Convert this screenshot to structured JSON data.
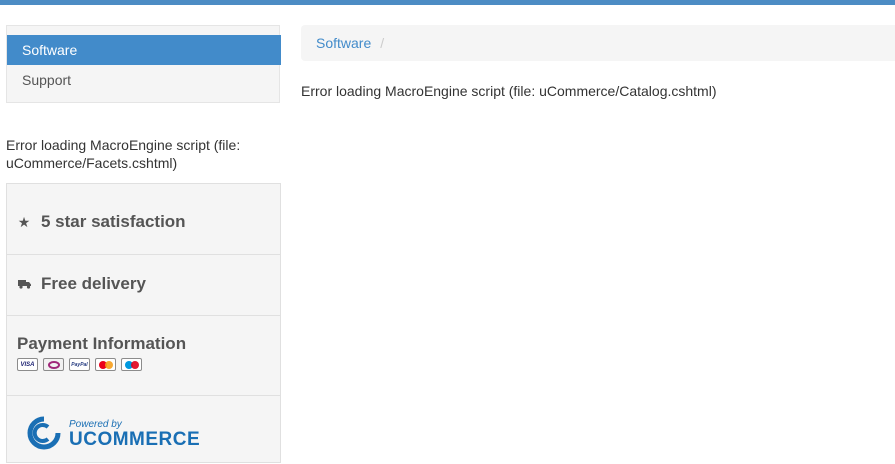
{
  "nav": {
    "items": [
      {
        "label": "Software"
      },
      {
        "label": "Support"
      }
    ]
  },
  "left_error": "Error loading MacroEngine script (file: uCommerce/Facets.cshtml)",
  "features": {
    "satisfaction": {
      "icon": "star-icon",
      "label": "5 star satisfaction"
    },
    "delivery": {
      "icon": "truck-icon",
      "label": "Free delivery"
    },
    "payment": {
      "label": "Payment Information",
      "cards": [
        {
          "name": "visa",
          "text": "VISA"
        },
        {
          "name": "maestro-alt",
          "text": ""
        },
        {
          "name": "paypal",
          "text": "PayPal"
        },
        {
          "name": "mastercard",
          "text": ""
        },
        {
          "name": "maestro",
          "text": ""
        }
      ]
    },
    "powered": {
      "prefix": "Powered by",
      "brand": "UCOMMERCE"
    }
  },
  "breadcrumb": {
    "items": [
      {
        "label": "Software"
      }
    ],
    "separator": "/"
  },
  "main_error": "Error loading MacroEngine script (file: uCommerce/Catalog.cshtml)",
  "colors": {
    "accent": "#428bca",
    "topbar": "#4c8cc4",
    "brand": "#1a6fb4"
  }
}
